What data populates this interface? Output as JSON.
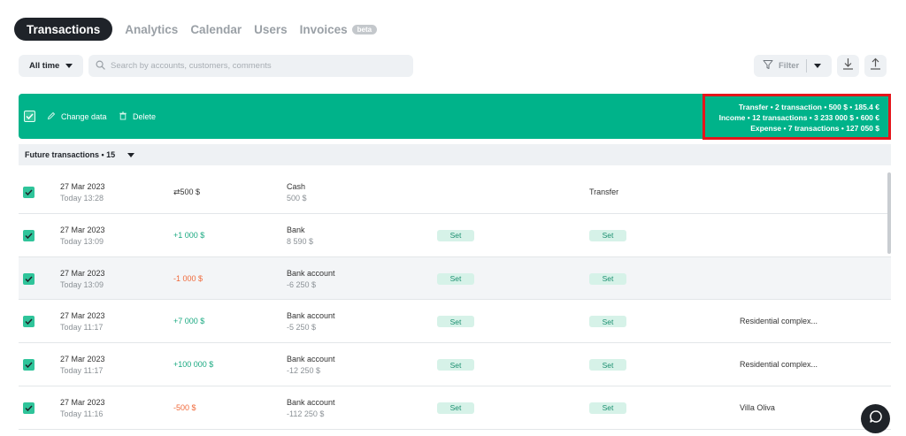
{
  "nav": {
    "active_tab": "Transactions",
    "tabs": [
      "Analytics",
      "Calendar",
      "Users",
      "Invoices"
    ],
    "badge": "beta"
  },
  "filters": {
    "period": "All time",
    "search_placeholder": "Search by accounts, customers, comments",
    "filter_label": "Filter"
  },
  "actionbar": {
    "change_label": "Change data",
    "delete_label": "Delete",
    "summary": [
      "Transfer • 2 transaction • 500  $  • 185.4 €",
      "Income • 12 transactions • 3 233 000  $  • 600 €",
      "Expense • 7 transactions • 127 050  $"
    ]
  },
  "group": {
    "label": "Future transactions • 15"
  },
  "rows": [
    {
      "date": "27 Mar 2023",
      "time": "Today 13:28",
      "amount": "⇄500  $",
      "kind": "neu",
      "account": "Cash",
      "balance": "500  $",
      "set1": "",
      "set2": "",
      "type": "Transfer",
      "desc": ""
    },
    {
      "date": "27 Mar 2023",
      "time": "Today 13:09",
      "amount": "+1 000  $",
      "kind": "pos",
      "account": "Bank",
      "balance": "8 590  $",
      "set1": "Set",
      "set2": "Set",
      "type": "",
      "desc": ""
    },
    {
      "date": "27 Mar 2023",
      "time": "Today 13:09",
      "amount": "-1 000  $",
      "kind": "neg",
      "account": "Bank account",
      "balance": "-6 250  $",
      "set1": "Set",
      "set2": "Set",
      "type": "",
      "desc": ""
    },
    {
      "date": "27 Mar 2023",
      "time": "Today 11:17",
      "amount": "+7 000  $",
      "kind": "pos",
      "account": "Bank account",
      "balance": "-5 250  $",
      "set1": "Set",
      "set2": "Set",
      "type": "",
      "desc": "Residential complex..."
    },
    {
      "date": "27 Mar 2023",
      "time": "Today 11:17",
      "amount": "+100 000  $",
      "kind": "pos",
      "account": "Bank account",
      "balance": "-12 250  $",
      "set1": "Set",
      "set2": "Set",
      "type": "",
      "desc": "Residential complex..."
    },
    {
      "date": "27 Mar 2023",
      "time": "Today 11:16",
      "amount": "-500  $",
      "kind": "neg",
      "account": "Bank account",
      "balance": "-112 250  $",
      "set1": "Set",
      "set2": "Set",
      "type": "",
      "desc": "Villa Oliva"
    }
  ],
  "colors": {
    "accent": "#00b38a",
    "dark": "#1f2329",
    "highlight": "#e5151b",
    "positive": "#1aa981",
    "negative": "#f06a3b"
  }
}
